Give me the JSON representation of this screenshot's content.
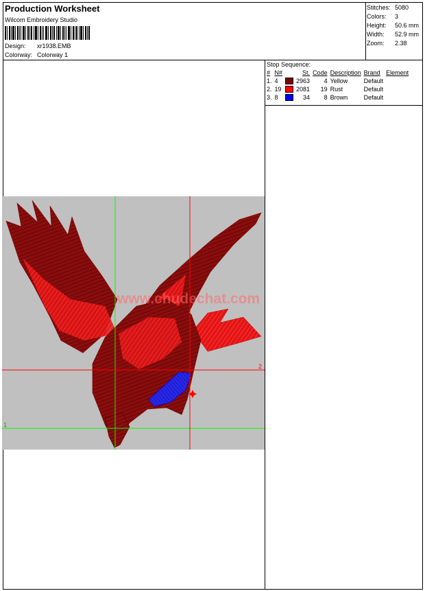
{
  "header": {
    "title": "Production Worksheet",
    "software": "Wilcom Embroidery Studio",
    "design_label": "Design:",
    "design_value": "xr1938.EMB",
    "colorway_label": "Colorway:",
    "colorway_value": "Colorway 1"
  },
  "stats": [
    {
      "label": "Stitches:",
      "value": "5080"
    },
    {
      "label": "Colors:",
      "value": "3"
    },
    {
      "label": "Height:",
      "value": "50.6 mm"
    },
    {
      "label": "Width:",
      "value": "52.9 mm"
    },
    {
      "label": "Zoom:",
      "value": "2.38"
    }
  ],
  "stop_sequence": {
    "title": "Stop Sequence:",
    "columns": [
      "#",
      "N#",
      "St.",
      "Code",
      "Description",
      "Brand",
      "Element"
    ],
    "rows": [
      {
        "num": "1.",
        "n": "4",
        "color": "#7a0000",
        "stitches": "2963",
        "code": "4",
        "description": "Yellow",
        "brand": "Default",
        "element": ""
      },
      {
        "num": "2.",
        "n": "19",
        "color": "#ff0000",
        "stitches": "2081",
        "code": "19",
        "description": "Rust",
        "brand": "Default",
        "element": ""
      },
      {
        "num": "3.",
        "n": "8",
        "color": "#0000ff",
        "stitches": "34",
        "code": "8",
        "description": "Brown",
        "brand": "Default",
        "element": ""
      }
    ]
  },
  "preview": {
    "marker_1": "1",
    "marker_2": "2",
    "watermark": "www.chudechat.com",
    "guide_green": "#00ff00",
    "guide_red": "#ff0000",
    "background": "#c0c0c0"
  }
}
